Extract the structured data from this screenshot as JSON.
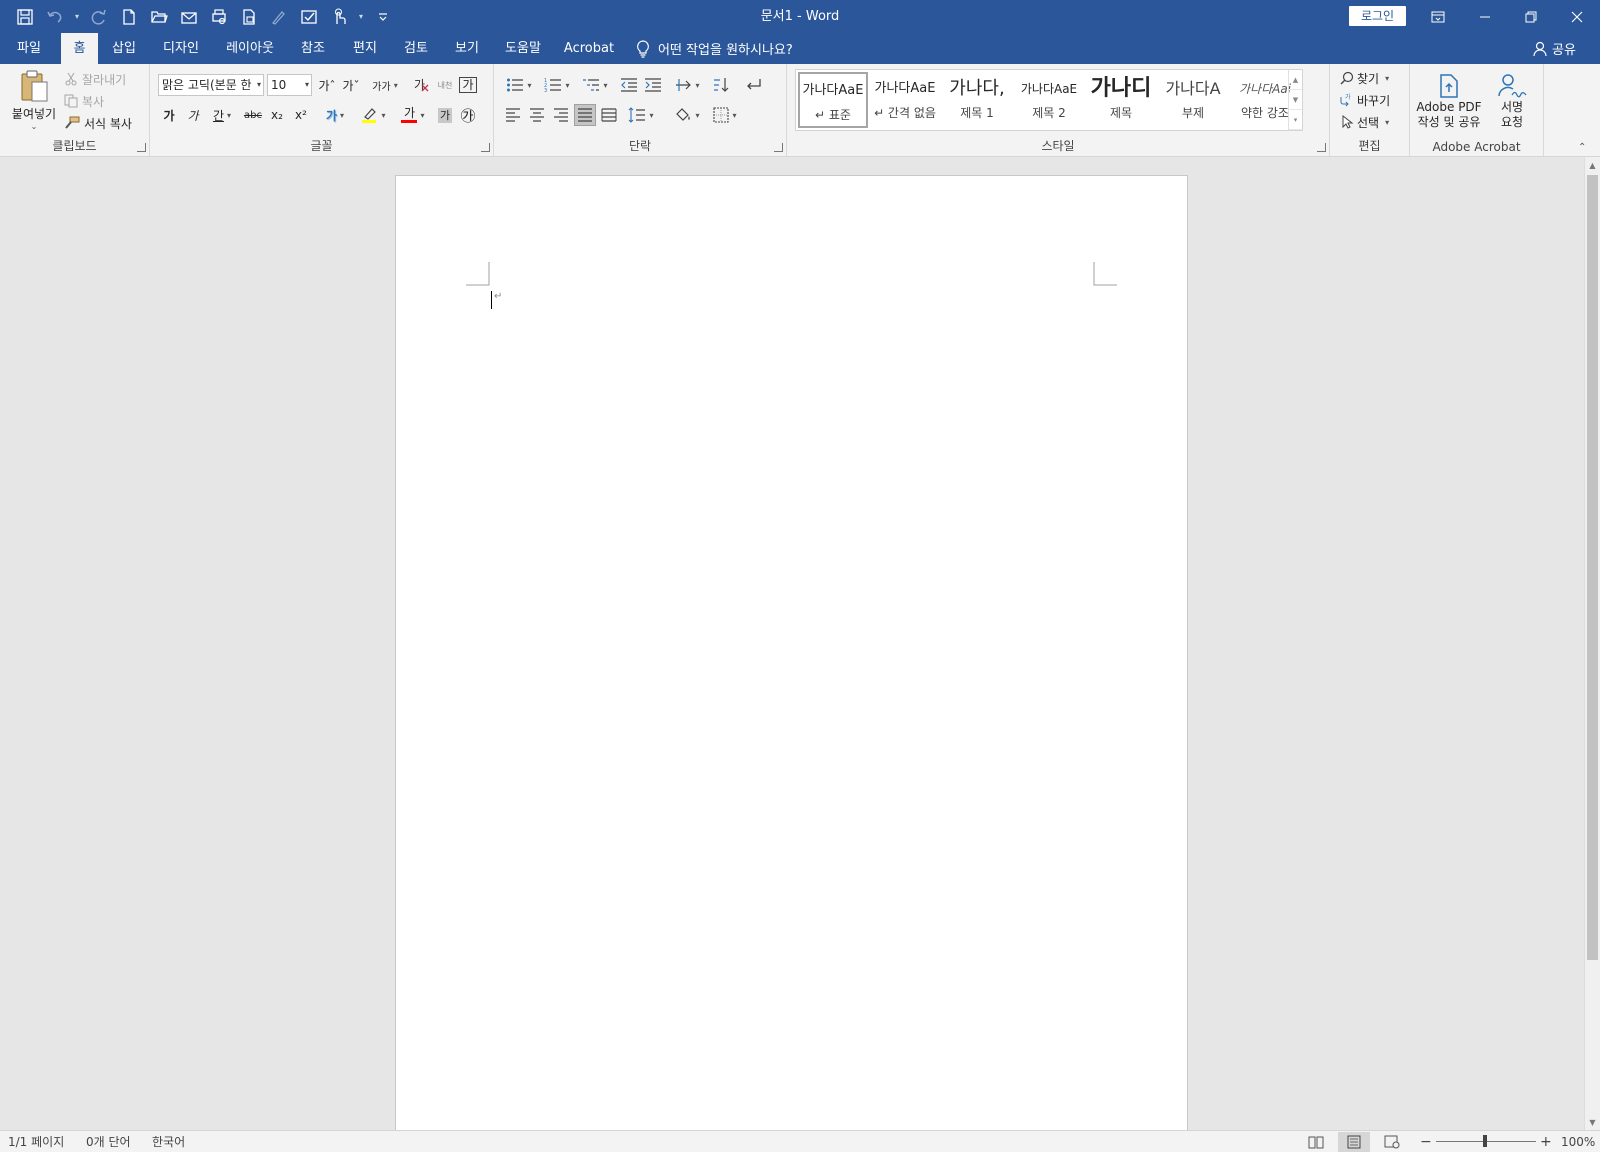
{
  "titlebar": {
    "title": "문서1  -  Word",
    "login_label": "로그인",
    "background": "#2b579a"
  },
  "qat": {
    "icons": [
      "save-icon",
      "undo-icon",
      "redo-icon",
      "new-doc-icon",
      "open-icon",
      "email-icon",
      "print-preview-icon",
      "quick-print-icon",
      "draw-icon",
      "spelling-icon",
      "touch-mode-icon",
      "customize-qat-icon"
    ]
  },
  "tabs": [
    {
      "label": "파일"
    },
    {
      "label": "홈",
      "active": true
    },
    {
      "label": "삽입"
    },
    {
      "label": "디자인"
    },
    {
      "label": "레이아웃"
    },
    {
      "label": "참조"
    },
    {
      "label": "편지"
    },
    {
      "label": "검토"
    },
    {
      "label": "보기"
    },
    {
      "label": "도움말"
    },
    {
      "label": "Acrobat"
    }
  ],
  "tell_me": "어떤 작업을 원하시나요?",
  "share_label": "공유",
  "ribbon": {
    "clipboard": {
      "label": "클립보드",
      "paste": "붙여넣기",
      "cut": "잘라내기",
      "copy": "복사",
      "format_painter": "서식 복사"
    },
    "font": {
      "label": "글꼴",
      "font_name": "맑은 고딕(본문 한",
      "font_size": "10",
      "grow": "가ˆ",
      "shrink": "가ˇ",
      "case": "가가",
      "clear_format": "가",
      "phonetic": "내천",
      "char_border": "가",
      "bold": "가",
      "italic": "가",
      "underline": "간",
      "strike": "abc",
      "subscript": "x₂",
      "superscript": "x²",
      "text_effect": "가",
      "highlight_color": "#ffff00",
      "font_color_label": "가",
      "font_color": "#ff0000",
      "shading_char": "가",
      "enclose": "㉮"
    },
    "paragraph": {
      "label": "단락"
    },
    "styles": {
      "label": "스타일",
      "items": [
        {
          "preview": "가나다AaE",
          "name": "↵ 표준"
        },
        {
          "preview": "가나다AaE",
          "name": "↵ 간격 없음"
        },
        {
          "preview": "가나다,",
          "name": "제목 1"
        },
        {
          "preview": "가나다AaE",
          "name": "제목 2"
        },
        {
          "preview": "가나디",
          "name": "제목"
        },
        {
          "preview": "가나다A",
          "name": "부제"
        },
        {
          "preview": "가나다Aai",
          "name": "약한 강조"
        }
      ]
    },
    "editing": {
      "label": "편집",
      "find": "찾기",
      "replace": "바꾸기",
      "select": "선택"
    },
    "acrobat": {
      "label": "Adobe Acrobat",
      "create_pdf_line1": "Adobe PDF",
      "create_pdf_line2": "작성 및 공유",
      "sign_line1": "서명",
      "sign_line2": "요청"
    }
  },
  "statusbar": {
    "page": "1/1 페이지",
    "words": "0개 단어",
    "language": "한국어",
    "zoom_minus": "−",
    "zoom_plus": "+",
    "zoom": "100%"
  }
}
